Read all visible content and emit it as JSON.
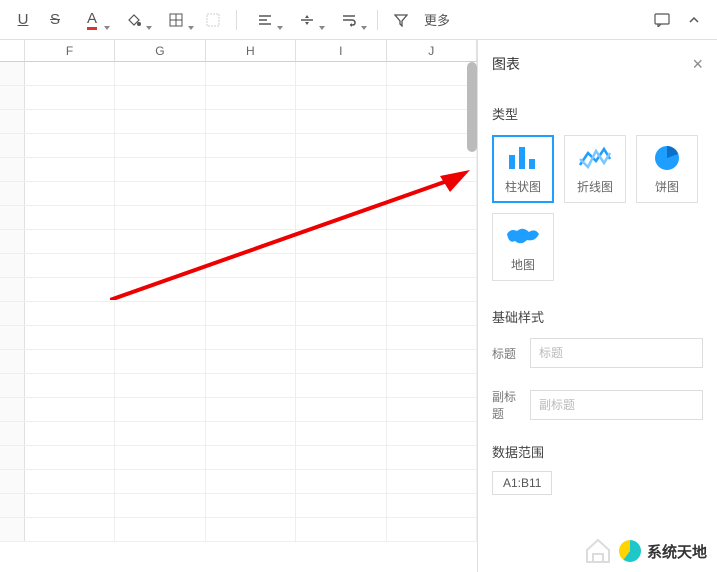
{
  "toolbar": {
    "more_label": "更多"
  },
  "columns": [
    "",
    "F",
    "G",
    "H",
    "I",
    "J"
  ],
  "panel": {
    "title": "图表",
    "section_type": "类型",
    "types": {
      "bar": "柱状图",
      "line": "折线图",
      "pie": "饼图",
      "map": "地图"
    },
    "section_style": "基础样式",
    "title_label": "标题",
    "title_placeholder": "标题",
    "subtitle_label": "副标题",
    "subtitle_placeholder": "副标题",
    "range_label": "数据范围",
    "range_value": "A1:B11"
  },
  "watermark": "系统天地"
}
